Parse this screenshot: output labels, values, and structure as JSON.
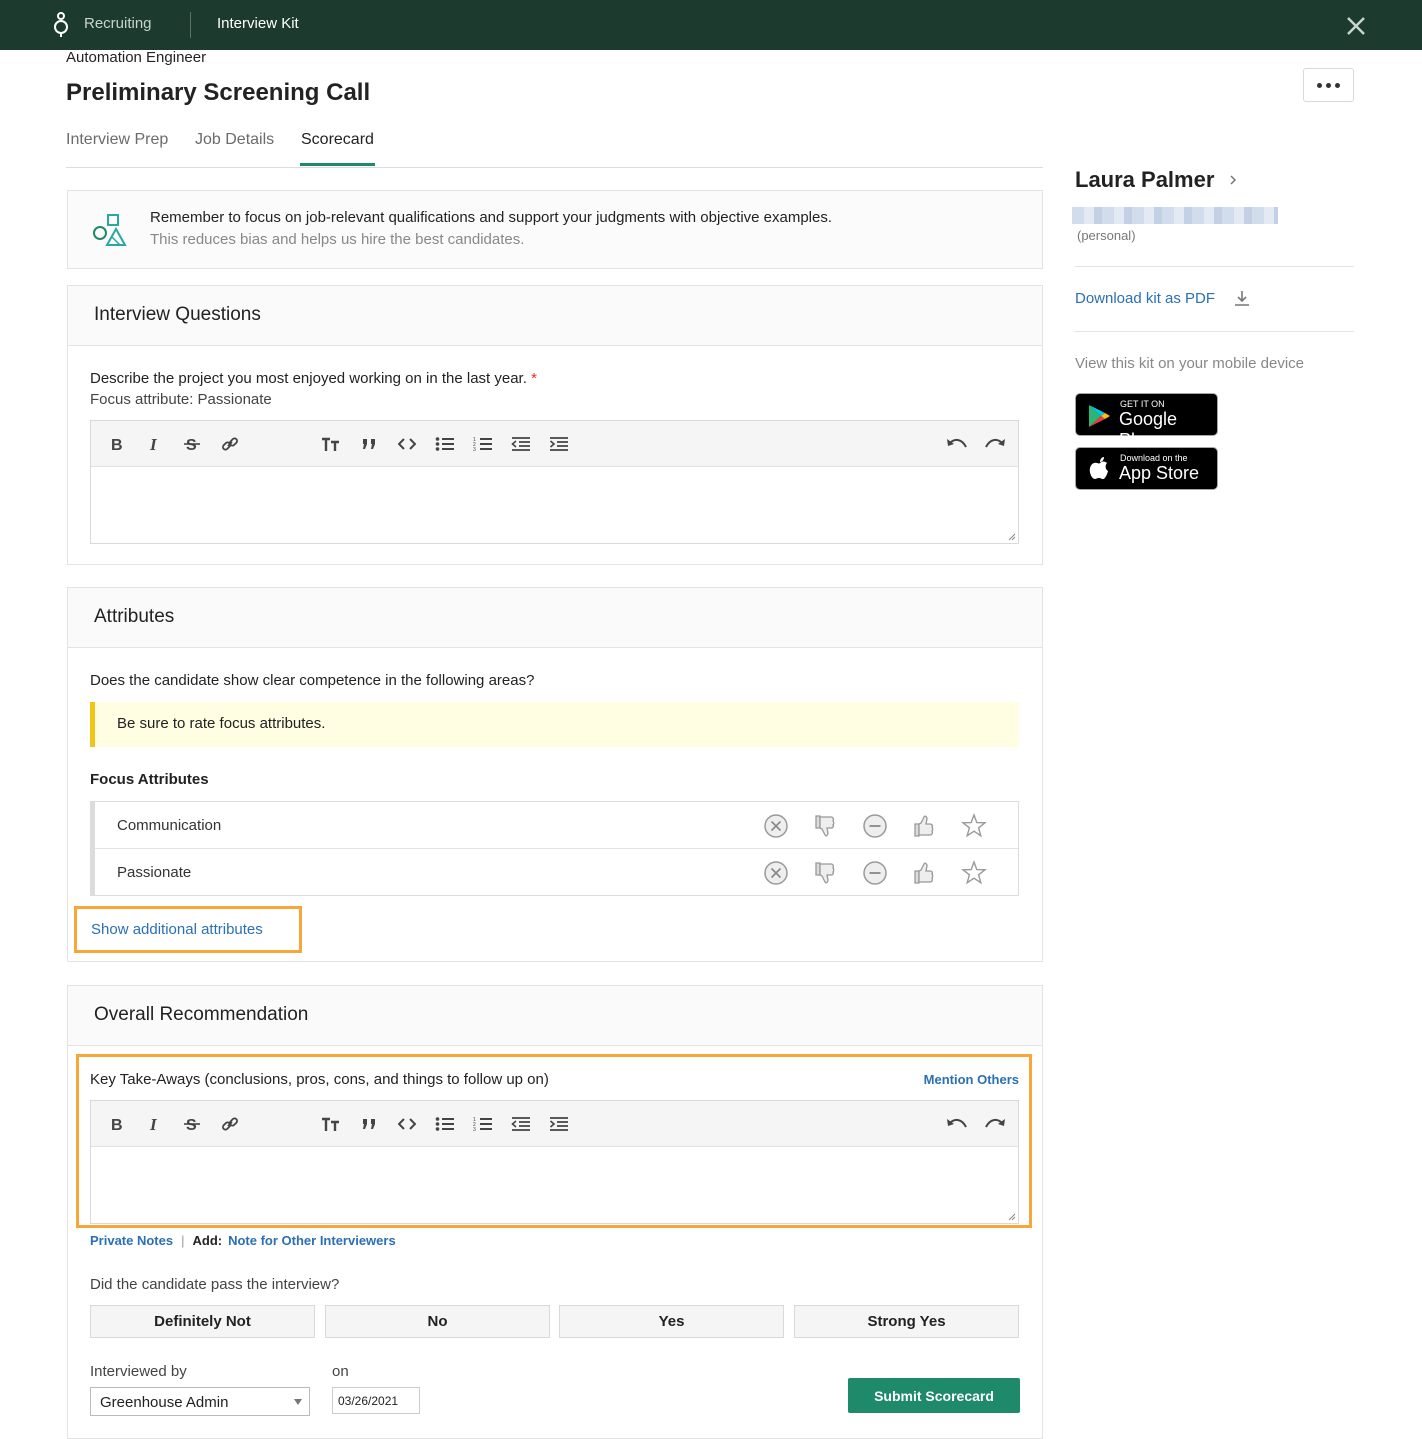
{
  "topbar": {
    "app_name": "Recruiting",
    "section": "Interview Kit"
  },
  "header": {
    "job_name": "Automation Engineer",
    "title": "Preliminary Screening Call"
  },
  "tabs": [
    {
      "label": "Interview Prep",
      "active": false
    },
    {
      "label": "Job Details",
      "active": false
    },
    {
      "label": "Scorecard",
      "active": true
    }
  ],
  "reminder": {
    "line1": "Remember to focus on job-relevant qualifications and support your judgments with objective examples.",
    "line2": "This reduces bias and helps us hire the best candidates."
  },
  "interview_questions": {
    "heading": "Interview Questions",
    "question": "Describe the project you most enjoyed working on in the last year.",
    "required_mark": "*",
    "focus_attribute": "Focus attribute: Passionate",
    "answer": ""
  },
  "attributes": {
    "heading": "Attributes",
    "question": "Does the candidate show clear competence in the following areas?",
    "warning": "Be sure to rate focus attributes.",
    "focus_heading": "Focus Attributes",
    "items": [
      {
        "name": "Communication"
      },
      {
        "name": "Passionate"
      }
    ],
    "rating_icons": [
      "definitely-not-icon",
      "thumbs-down-icon",
      "neutral-icon",
      "thumbs-up-icon",
      "star-icon"
    ],
    "show_more": "Show additional attributes"
  },
  "overall": {
    "heading": "Overall Recommendation",
    "takeaways_label": "Key Take-Aways (conclusions, pros, cons, and things to follow up on)",
    "mention_others": "Mention Others",
    "private_notes": "Private Notes",
    "add_label": "Add:",
    "note_for_others": "Note for Other Interviewers",
    "pass_question": "Did the candidate pass the interview?",
    "pass_options": [
      "Definitely Not",
      "No",
      "Yes",
      "Strong Yes"
    ],
    "interviewed_by_label": "Interviewed by",
    "interviewer": "Greenhouse Admin",
    "on_label": "on",
    "date": "03/26/2021",
    "submit": "Submit Scorecard"
  },
  "sidebar": {
    "candidate_name": "Laura Palmer",
    "email_type": "(personal)",
    "download_pdf": "Download kit as PDF",
    "mobile_text": "View this kit on your mobile device",
    "google_play_small": "GET IT ON",
    "google_play_big": "Google Play",
    "app_store_small": "Download on the",
    "app_store_big": "App Store"
  },
  "colors": {
    "topbar": "#1c3a2e",
    "accent_green": "#1e8a6a",
    "link_blue": "#2b6fb6",
    "highlight_orange": "#f7a738",
    "warning_bg": "#fffde2"
  }
}
